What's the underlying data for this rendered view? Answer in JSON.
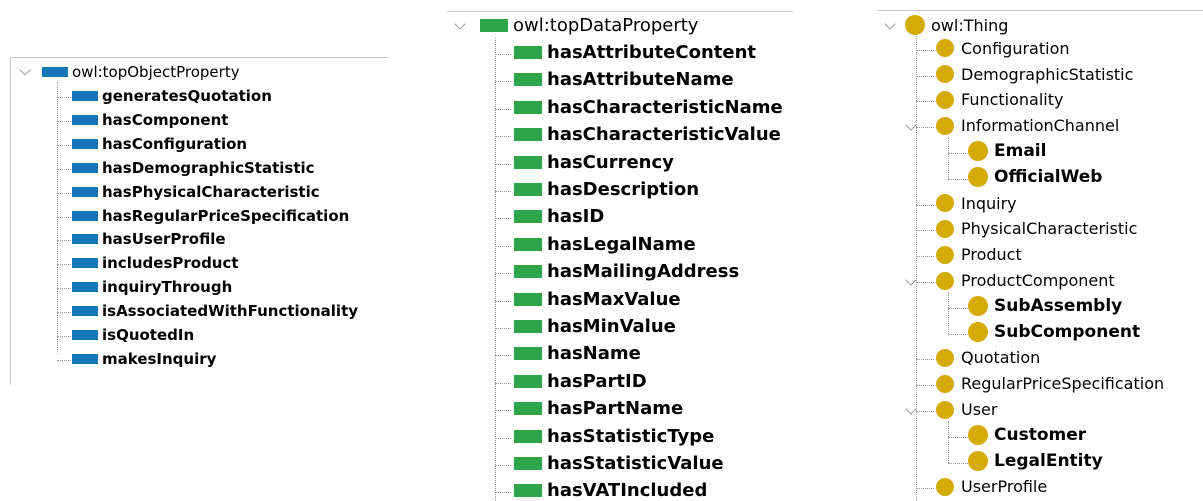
{
  "object_properties": {
    "root": "owl:topObjectProperty",
    "items": [
      "generatesQuotation",
      "hasComponent",
      "hasConfiguration",
      "hasDemographicStatistic",
      "hasPhysicalCharacteristic",
      "hasRegularPriceSpecification",
      "hasUserProfile",
      "includesProduct",
      "inquiryThrough",
      "isAssociatedWithFunctionality",
      "isQuotedIn",
      "makesInquiry"
    ],
    "color": "#1478b8"
  },
  "data_properties": {
    "root": "owl:topDataProperty",
    "items": [
      "hasAttributeContent",
      "hasAttributeName",
      "hasCharacteristicName",
      "hasCharacteristicValue",
      "hasCurrency",
      "hasDescription",
      "hasID",
      "hasLegalName",
      "hasMailingAddress",
      "hasMaxValue",
      "hasMinValue",
      "hasName",
      "hasPartID",
      "hasPartName",
      "hasStatisticType",
      "hasStatisticValue",
      "hasVATIncluded"
    ],
    "color": "#2fa54a"
  },
  "classes": {
    "root": "owl:Thing",
    "items": [
      {
        "label": "Configuration"
      },
      {
        "label": "DemographicStatistic"
      },
      {
        "label": "Functionality"
      },
      {
        "label": "InformationChannel",
        "children": [
          "Email",
          "OfficialWeb"
        ]
      },
      {
        "label": "Inquiry"
      },
      {
        "label": "PhysicalCharacteristic"
      },
      {
        "label": "Product"
      },
      {
        "label": "ProductComponent",
        "children": [
          "SubAssembly",
          "SubComponent"
        ]
      },
      {
        "label": "Quotation"
      },
      {
        "label": "RegularPriceSpecification"
      },
      {
        "label": "User",
        "children": [
          "Customer",
          "LegalEntity"
        ]
      },
      {
        "label": "UserProfile"
      }
    ],
    "color": "#d4ab07"
  }
}
